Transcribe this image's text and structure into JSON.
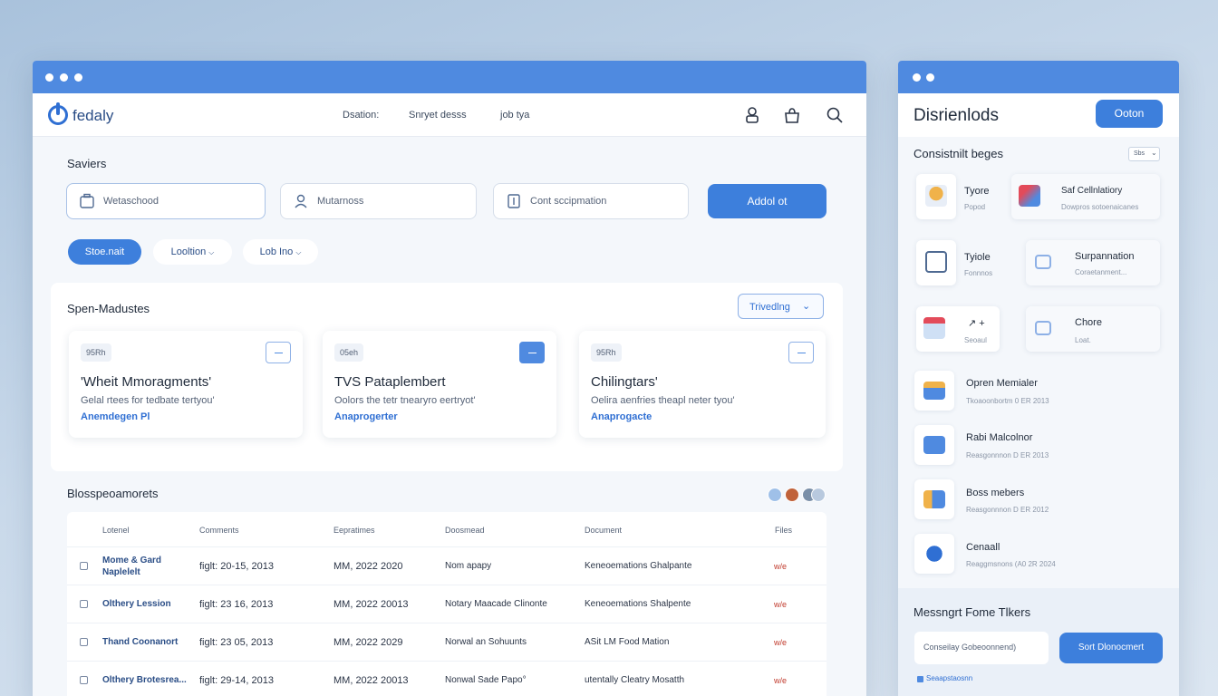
{
  "main": {
    "logo": "fedaly",
    "nav": [
      "Dsation:",
      "Snryet desss",
      "job tya"
    ],
    "section_search": "Saviers",
    "fields": [
      {
        "placeholder": "Wetaschood"
      },
      {
        "placeholder": "Mutarnoss"
      },
      {
        "placeholder": "Cont sccipmation"
      }
    ],
    "add_button": "Addol ot",
    "filters": [
      {
        "label": "Stoe.nait",
        "active": true
      },
      {
        "label": "Looltion",
        "chevron": true
      },
      {
        "label": "Lob Ino",
        "chevron": true
      }
    ],
    "section_cards": "Spen-Madustes",
    "trending_label": "Trivedlng",
    "cards": [
      {
        "badge": "95Rh",
        "title": "'Wheit Mmoragments'",
        "desc": "Gelal rtees for tedbate tertyou'",
        "link": "Anemdegen Pl"
      },
      {
        "badge": "05eh",
        "title": "TVS Pataplembert",
        "desc": "Oolors the tetr tnearyro eertryot'",
        "link": "Anaprogerter"
      },
      {
        "badge": "95Rh",
        "title": "Chilingtars'",
        "desc": "Oelira aenfries theapl neter tyou'",
        "link": "Anaprogacte"
      }
    ],
    "section_table": "Blosspeoamorets",
    "table": {
      "headers": [
        "Lotenel",
        "Comments",
        "Eepratimes",
        "Doosmead",
        "Document",
        "Files"
      ],
      "rows": [
        {
          "name": "Mome & Gard Naplelelt",
          "comment": "figlt: 20-15, 2013",
          "date": "MM, 2022 2020",
          "doc": "Nom apapy",
          "document": "Keneoemations Ghalpante",
          "file": "w/e"
        },
        {
          "name": "Olthery Lession",
          "comment": "figlt: 23 16, 2013",
          "date": "MM, 2022 20013",
          "doc": "Notary Maacade Clinonte",
          "document": "Keneoemations Shalpente",
          "file": "w/e"
        },
        {
          "name": "Thand Coonanort",
          "comment": "figlt: 23 05, 2013",
          "date": "MM, 2022 2029",
          "doc": "Norwal an Sohuunts",
          "document": "ASit LM Food Mation",
          "file": "w/e"
        },
        {
          "name": "Olthery Brotesrea...",
          "comment": "figlt: 29-14, 2013",
          "date": "MM, 2022 20013",
          "doc": "Nonwal Sade Papo°",
          "document": "utentally Cleatry Mosatth",
          "file": "w/e"
        }
      ]
    }
  },
  "side": {
    "title": "Disrienlods",
    "option_button": "Ooton",
    "section": "Consistnilt beges",
    "section_select": "Sbs",
    "tiles": [
      {
        "title": "Tyore",
        "sub": "Popod"
      },
      {
        "title": "Saf Cellnlatiory",
        "sub": "Dowpros sotoenaicanes"
      },
      {
        "title": "Tyiole",
        "sub": "Fonnnos"
      },
      {
        "title": "Surpannation",
        "sub": "Coraetanment..."
      },
      {
        "title": "↗ +",
        "sub": "Seoaul"
      },
      {
        "title": "Chore",
        "sub": "Loat."
      }
    ],
    "list": [
      {
        "title": "Opren Memialer",
        "sub": "Tkoaoonbortm 0 ER 2013"
      },
      {
        "title": "Rabi Malcolnor",
        "sub": "Reasgonnnon D ER 2013"
      },
      {
        "title": "Boss mebers",
        "sub": "Reasgonnnon D ER 2012"
      },
      {
        "title": "Cenaall",
        "sub": "Reaggmsnons (A0 2R 2024"
      }
    ],
    "footer_title": "Messngrt Fome Tlkers",
    "footer_input": "Conseilay Gobeoonnend)",
    "footer_button": "Sort Dlonocmert",
    "footer_link": "Seaapstaosnn"
  },
  "colors": {
    "accent": "#3d7fdc",
    "titlebar": "#4f8ae0",
    "link": "#2f6fd3"
  }
}
